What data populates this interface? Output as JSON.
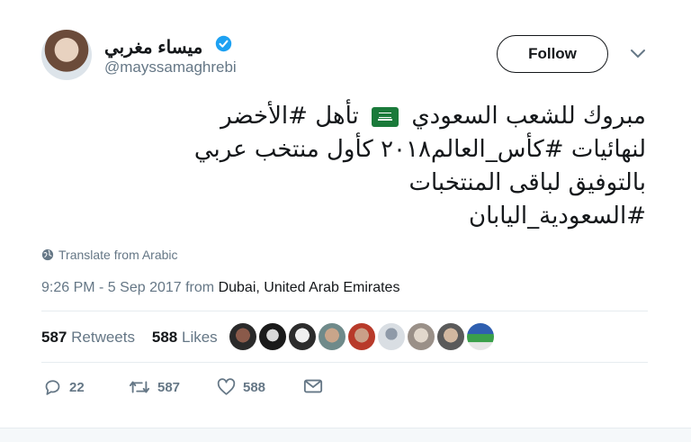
{
  "author": {
    "display_name": "ميساء مغربي",
    "handle": "@mayssamaghrebi",
    "verified": true
  },
  "follow_button": {
    "label": "Follow"
  },
  "tweet": {
    "lines": [
      "مبروك للشعب السعودي 🇸🇦 تأهل #الأخضر",
      "لنهائيات #كأس_العالم٢٠١٨ كأول منتخب عربي",
      "بالتوفيق لباقى المنتخبات",
      "#السعودية_اليابان"
    ],
    "line1_before_flag": "مبروك للشعب السعودي",
    "line1_after_flag": "تأهل #الأخضر"
  },
  "translate": {
    "label": "Translate from Arabic"
  },
  "meta": {
    "time_date": "9:26 PM - 5 Sep 2017 from",
    "location": "Dubai, United Arab Emirates"
  },
  "stats": {
    "retweets_count": "587",
    "retweets_label": "Retweets",
    "likes_count": "588",
    "likes_label": "Likes"
  },
  "actions": {
    "reply_count": "22",
    "retweet_count": "587",
    "like_count": "588"
  },
  "colors": {
    "accent_blue": "#1da1f2",
    "text_primary": "#14171a",
    "text_secondary": "#657786",
    "divider": "#e6ecf0",
    "flag_green": "#1a7a3a"
  },
  "icons": [
    "verified-badge-icon",
    "chevron-down-icon",
    "globe-icon",
    "reply-icon",
    "retweet-icon",
    "heart-icon",
    "envelope-icon"
  ]
}
